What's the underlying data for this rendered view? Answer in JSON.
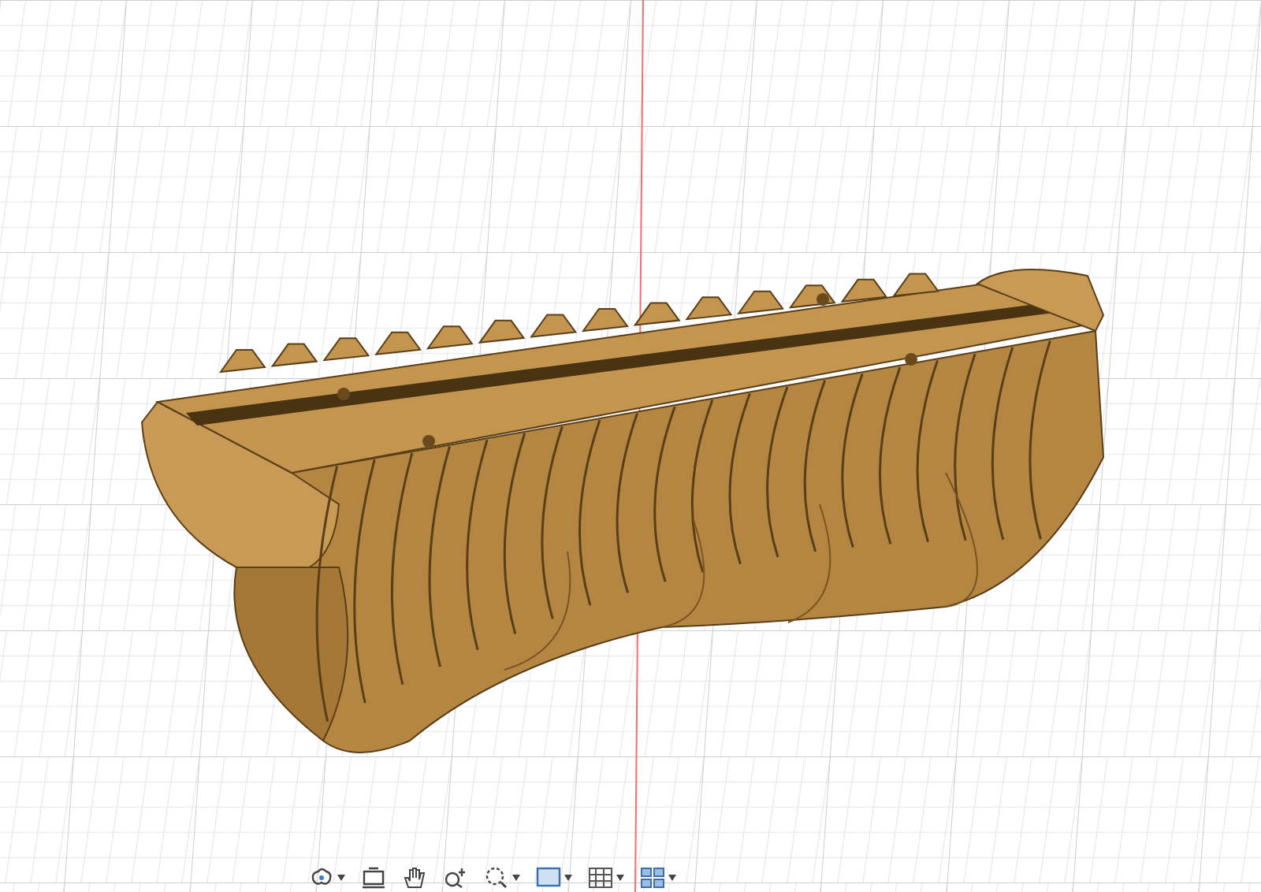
{
  "toolbar": {
    "tools": [
      {
        "kind": "orbit",
        "dropdown": true
      },
      {
        "kind": "look",
        "dropdown": false
      },
      {
        "kind": "pan",
        "dropdown": false
      },
      {
        "kind": "zoom",
        "dropdown": false
      },
      {
        "kind": "fit",
        "dropdown": true
      },
      {
        "kind": "display",
        "dropdown": true
      },
      {
        "kind": "grid",
        "dropdown": true
      },
      {
        "kind": "viewports",
        "dropdown": true
      }
    ]
  }
}
